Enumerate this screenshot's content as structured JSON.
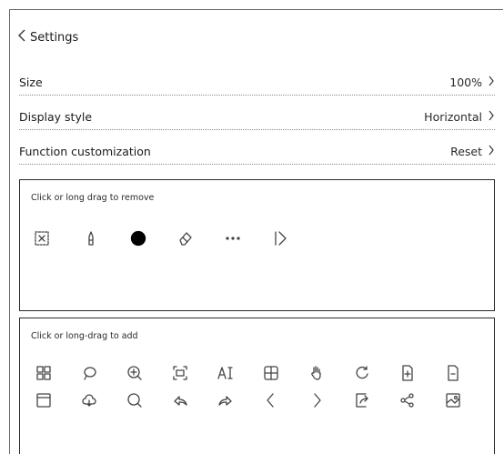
{
  "header": {
    "back_label": "Settings"
  },
  "rows": [
    {
      "label": "Size",
      "value": "100%"
    },
    {
      "label": "Display style",
      "value": "Horizontal"
    },
    {
      "label": "Function customization",
      "value": "Reset"
    }
  ],
  "remove_panel": {
    "title": "Click or long drag to remove",
    "icons": [
      "lasso-select-icon",
      "pen-icon",
      "filled-circle-icon",
      "eraser-icon",
      "more-icon",
      "collapse-toolbar-icon"
    ]
  },
  "add_panel": {
    "title": "Click or long-drag to add",
    "icons_row1": [
      "grid-icon",
      "lasso-icon",
      "zoom-in-icon",
      "fit-frame-icon",
      "ai-text-icon",
      "table-icon",
      "hand-icon",
      "refresh-icon",
      "add-page-icon",
      "page-icon"
    ],
    "icons_row2": [
      "save-icon",
      "cloud-icon",
      "search-icon",
      "undo-icon",
      "redo-icon",
      "previous-icon",
      "next-icon",
      "export-icon",
      "share-icon",
      "image-icon"
    ]
  }
}
